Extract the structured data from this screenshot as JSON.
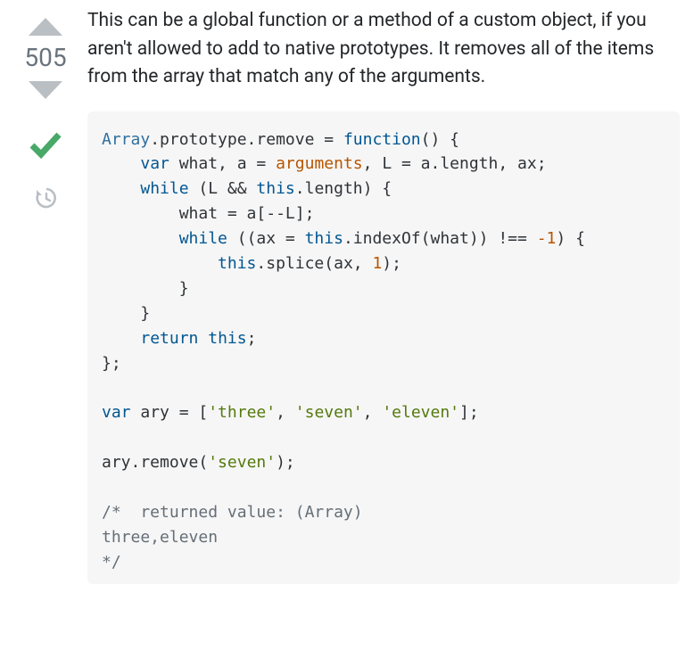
{
  "vote": {
    "count": "505"
  },
  "answer": {
    "prose": "This can be a global function or a method of a custom object, if you aren't allowed to add to native prototypes. It removes all of the items from the array that match any of the arguments.",
    "code": {
      "l1a": "Array",
      "l1b": ".prototype.remove = ",
      "l1c": "function",
      "l1d": "() {",
      "l2a": "    ",
      "l2b": "var",
      "l2c": " what, a = ",
      "l2d": "arguments",
      "l2e": ", L = a.length, ax;",
      "l3a": "    ",
      "l3b": "while",
      "l3c": " (L && ",
      "l3d": "this",
      "l3e": ".length) {",
      "l4a": "        what = a[--L];",
      "l5a": "        ",
      "l5b": "while",
      "l5c": " ((ax = ",
      "l5d": "this",
      "l5e": ".indexOf(what)) !== ",
      "l5f": "-1",
      "l5g": ") {",
      "l6a": "            ",
      "l6b": "this",
      "l6c": ".splice(ax, ",
      "l6d": "1",
      "l6e": ");",
      "l7a": "        }",
      "l8a": "    }",
      "l9a": "    ",
      "l9b": "return",
      "l9c": " ",
      "l9d": "this",
      "l9e": ";",
      "l10a": "};",
      "l12a": "var",
      "l12b": " ary = [",
      "l12c": "'three'",
      "l12d": ", ",
      "l12e": "'seven'",
      "l12f": ", ",
      "l12g": "'eleven'",
      "l12h": "];",
      "l14a": "ary.remove(",
      "l14b": "'seven'",
      "l14c": ");",
      "l16a": "/*  returned value: (Array)",
      "l17a": "three,eleven",
      "l18a": "*/"
    }
  }
}
